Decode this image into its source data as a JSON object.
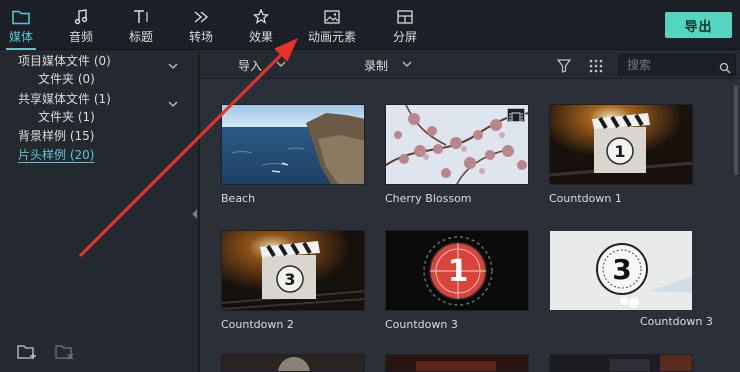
{
  "topbar": {
    "tabs": [
      {
        "label": "媒体",
        "icon": "folder-icon",
        "active": true
      },
      {
        "label": "音频",
        "icon": "music-note-icon",
        "active": false
      },
      {
        "label": "标题",
        "icon": "text-icon",
        "active": false
      },
      {
        "label": "转场",
        "icon": "transition-icon",
        "active": false
      },
      {
        "label": "效果",
        "icon": "effects-icon",
        "active": false
      },
      {
        "label": "动画元素",
        "icon": "image-icon",
        "active": false
      },
      {
        "label": "分屏",
        "icon": "split-screen-icon",
        "active": false
      }
    ],
    "export_label": "导出"
  },
  "sidebar": {
    "items": [
      {
        "label": "项目媒体文件 (0)",
        "expandable": true
      },
      {
        "label": "文件夹 (0)",
        "expandable": false
      },
      {
        "label": "共享媒体文件 (1)",
        "expandable": true
      },
      {
        "label": "文件夹 (1)",
        "expandable": false
      },
      {
        "label": "背景样例 (15)",
        "expandable": false
      },
      {
        "label": "片头样例 (20)",
        "expandable": false,
        "active": true
      }
    ]
  },
  "media": {
    "import_label": "导入",
    "record_label": "录制",
    "search_placeholder": "搜索",
    "tiles": [
      {
        "name": "Beach"
      },
      {
        "name": "Cherry Blossom"
      },
      {
        "name": "Countdown 1"
      },
      {
        "name": "Countdown 2"
      },
      {
        "name": "Countdown 3"
      },
      {
        "name": "Countdown 3"
      }
    ]
  },
  "colors": {
    "accent": "#58c7d2",
    "export_button": "#55d5c0",
    "annotation_arrow": "#e8322a",
    "background": "#242930",
    "panel": "#2b3038"
  }
}
